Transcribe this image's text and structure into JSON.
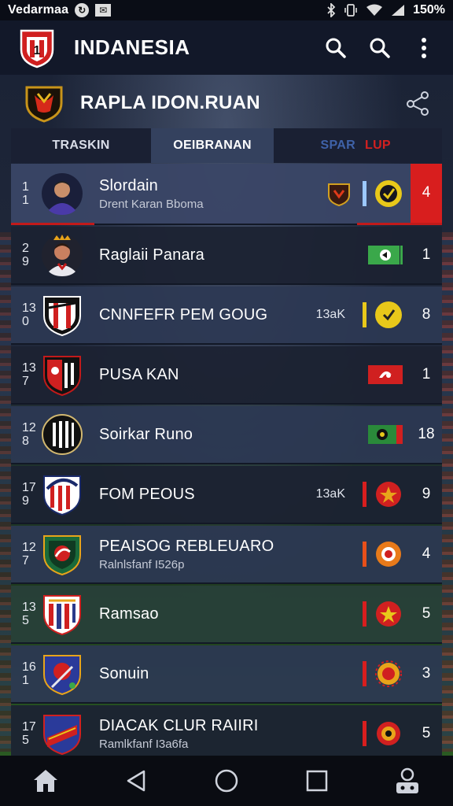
{
  "status_bar": {
    "carrier": "Vedarmaa",
    "battery": "150%",
    "icons": [
      "sync-icon",
      "mail-icon",
      "bluetooth-icon",
      "vibrate-icon",
      "wifi-icon",
      "signal-icon"
    ]
  },
  "app_bar": {
    "title": "INDANESIA",
    "actions": [
      "search-icon",
      "search-icon",
      "more-vert-icon"
    ]
  },
  "league": {
    "name": "RAPLA IDON.RUAN",
    "actions": [
      "share-icon"
    ]
  },
  "tabs": [
    {
      "label": "TRASKIN",
      "active": false
    },
    {
      "label": "OEIBRANAN",
      "active": true
    },
    {
      "label": "SPAR",
      "active": false
    },
    {
      "label": "LUP",
      "active": false
    }
  ],
  "rows": [
    {
      "rank_top": "1",
      "rank_bottom": "1",
      "name": "Slordain",
      "sub": "Drent Karan Bboma",
      "count": "",
      "points": "4",
      "avatar": "player",
      "highlight": true
    },
    {
      "rank_top": "2",
      "rank_bottom": "9",
      "name": "Raglaii Panara",
      "sub": "",
      "count": "",
      "points": "1",
      "avatar": "player2"
    },
    {
      "rank_top": "13",
      "rank_bottom": "0",
      "name": "CNNFEFR PEM GOUG",
      "sub": "",
      "count": "13aK",
      "points": "8",
      "avatar": "crest"
    },
    {
      "rank_top": "13",
      "rank_bottom": "7",
      "name": "PUSA KAN",
      "sub": "",
      "count": "",
      "points": "1",
      "avatar": "crest"
    },
    {
      "rank_top": "12",
      "rank_bottom": "8",
      "name": "Soirkar Runo",
      "sub": "",
      "count": "",
      "points": "18",
      "avatar": "crest"
    },
    {
      "rank_top": "17",
      "rank_bottom": "9",
      "name": "FOM PEOUS",
      "sub": "",
      "count": "13aK",
      "points": "9",
      "avatar": "crest"
    },
    {
      "rank_top": "12",
      "rank_bottom": "7",
      "name": "PEAISOG REBLEUARO",
      "sub": "Ralnlsfanf I526p",
      "count": "",
      "points": "4",
      "avatar": "crest"
    },
    {
      "rank_top": "13",
      "rank_bottom": "5",
      "name": "Ramsao",
      "sub": "",
      "count": "",
      "points": "5",
      "avatar": "crest"
    },
    {
      "rank_top": "16",
      "rank_bottom": "1",
      "name": "Sonuin",
      "sub": "",
      "count": "",
      "points": "3",
      "avatar": "crest"
    },
    {
      "rank_top": "17",
      "rank_bottom": "5",
      "name": "DIACAK CLUR RAIIRI",
      "sub": "Ramlkfanf I3a6fa",
      "count": "",
      "points": "5",
      "avatar": "crest"
    }
  ],
  "nav_bar": [
    "home-icon",
    "back-icon",
    "home-circle-icon",
    "recents-icon",
    "bot-icon"
  ],
  "colors": {
    "accent_red": "#d81e1e",
    "tab_active": "#34415e",
    "row_bg": "#2d3854",
    "status_yellow": "#e8c81a",
    "status_green": "#3aa84a"
  }
}
